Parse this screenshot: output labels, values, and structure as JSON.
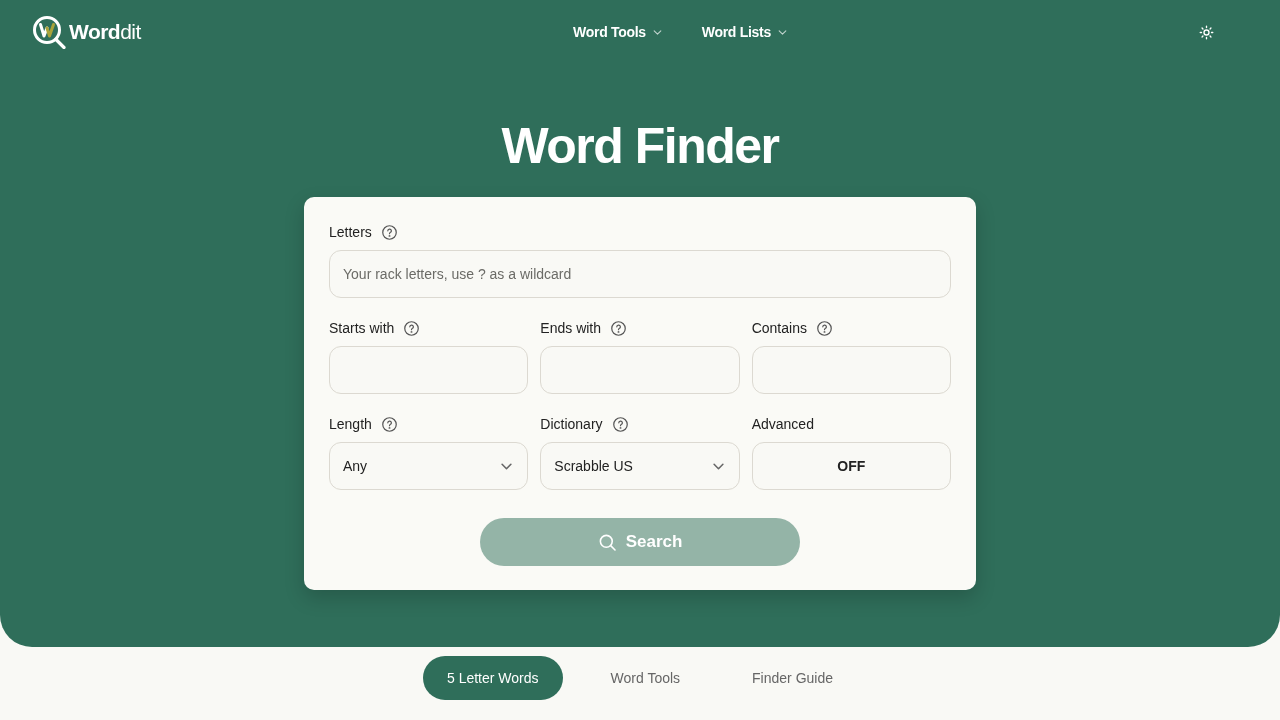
{
  "header": {
    "logo": "**Word**dit",
    "nav": [
      {
        "label": "Word Tools"
      },
      {
        "label": "Word Lists"
      }
    ]
  },
  "title": "Word Finder",
  "form": {
    "rows": [
      {
        "fields": [
          {
            "kind": "text",
            "label": "Letters",
            "help": true,
            "placeholder": "Your rack letters, use ? as a wildcard"
          }
        ]
      },
      {
        "fields": [
          {
            "kind": "text",
            "label": "Starts with",
            "help": true
          },
          {
            "kind": "text",
            "label": "Ends with",
            "help": true
          },
          {
            "kind": "text",
            "label": "Contains",
            "help": true
          }
        ]
      },
      {
        "fields": [
          {
            "kind": "select",
            "label": "Length",
            "help": true,
            "value": "Any"
          },
          {
            "kind": "select",
            "label": "Dictionary",
            "help": true,
            "value": "Scrabble US"
          },
          {
            "kind": "toggle",
            "label": "Advanced",
            "help": false,
            "value": "OFF"
          }
        ]
      }
    ],
    "search_button": {
      "label": "Search",
      "disabled": true
    }
  },
  "bottom_tabs": [
    {
      "label": "5 Letter Words",
      "selected": true
    },
    {
      "label": "Word Tools",
      "selected": false
    },
    {
      "label": "Finder Guide",
      "selected": false
    }
  ]
}
